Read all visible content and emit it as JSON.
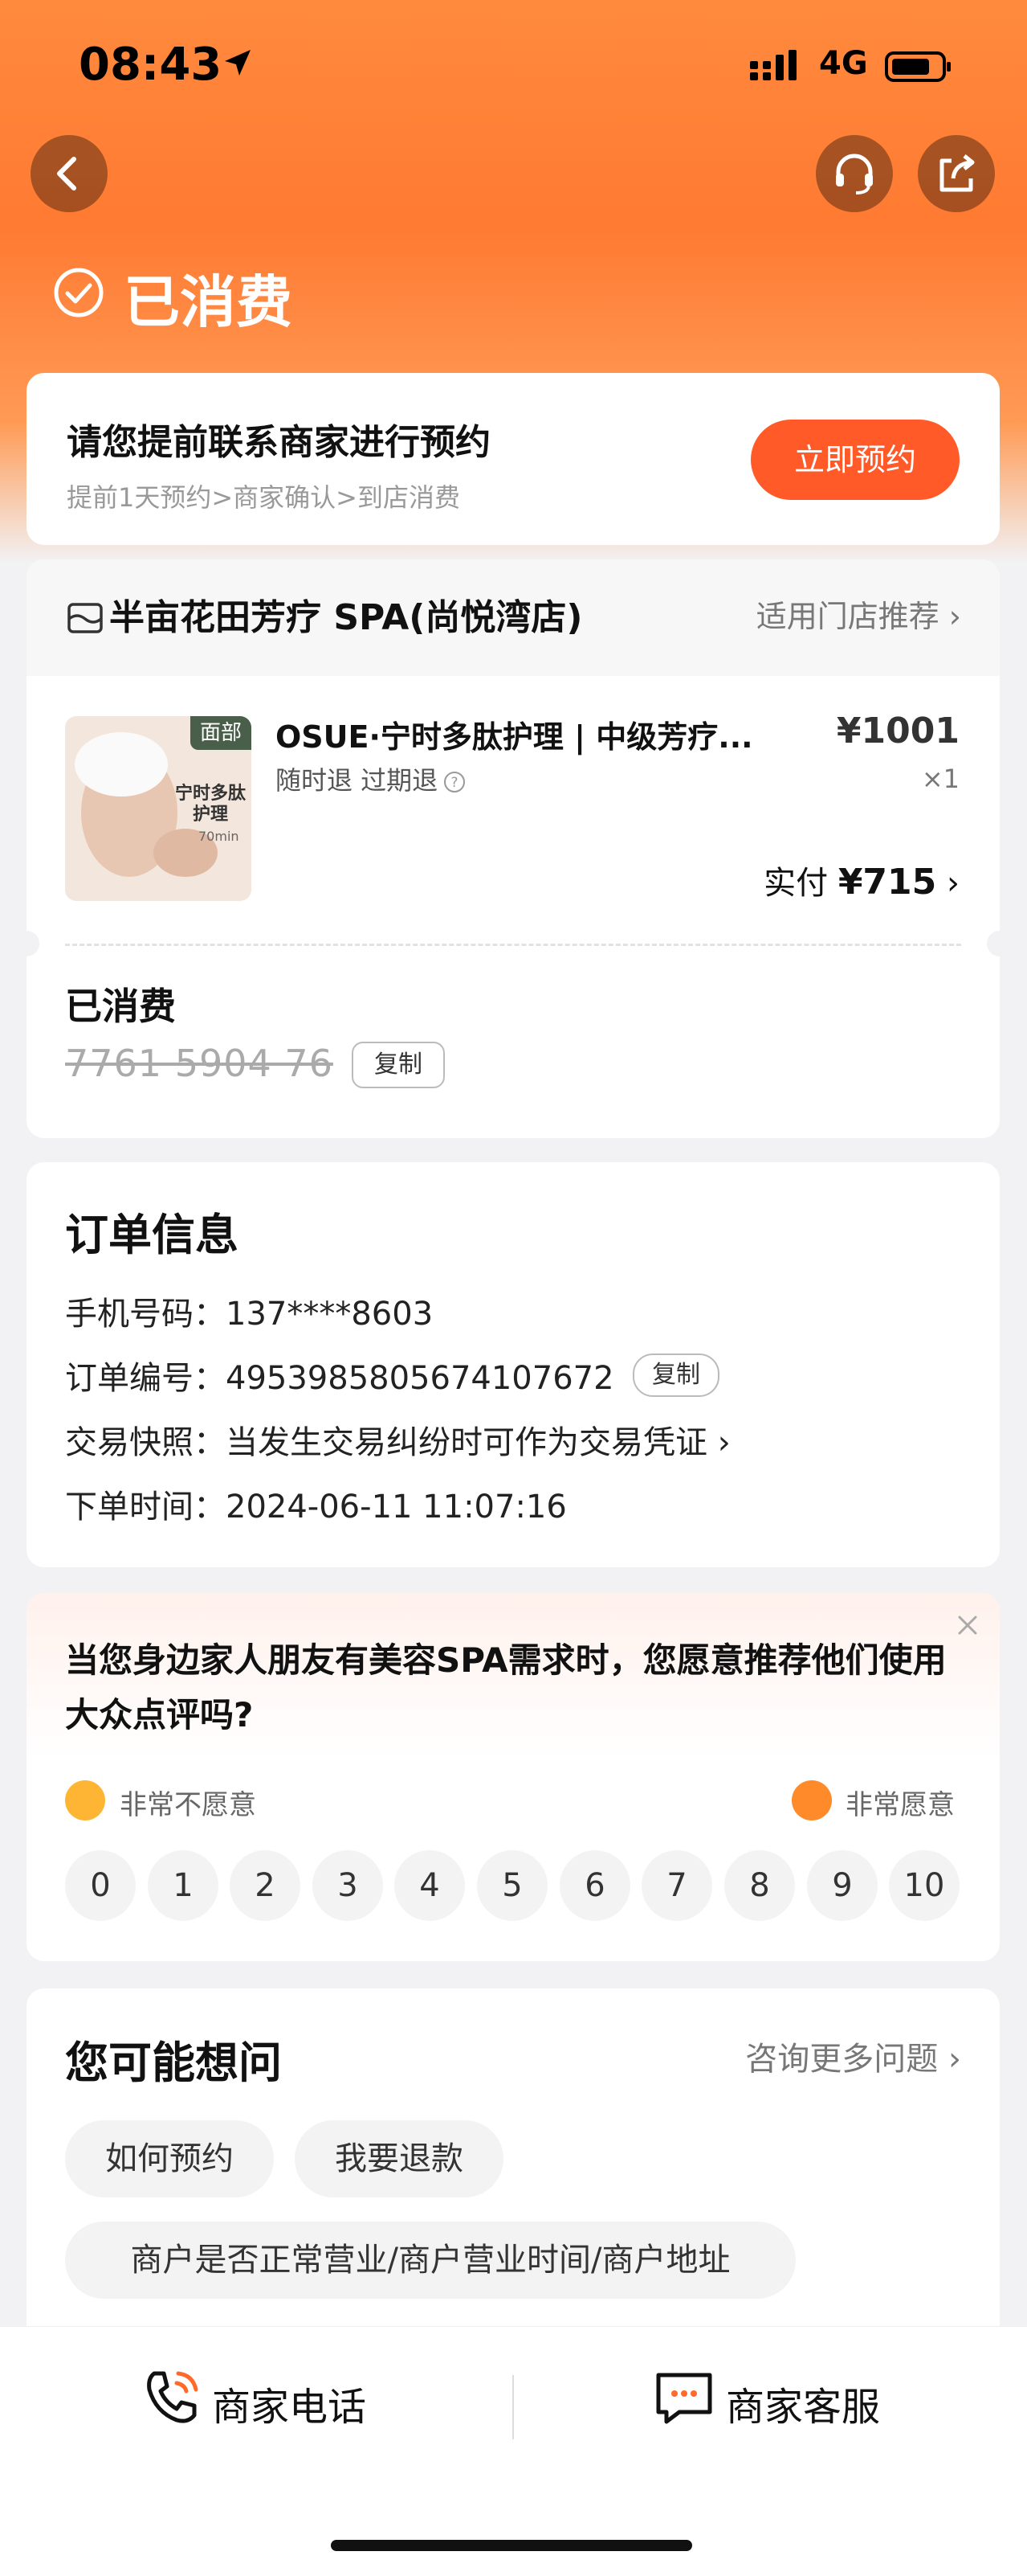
{
  "status_bar": {
    "time": "08:43",
    "network": "4G"
  },
  "header": {
    "status_title": "已消费"
  },
  "booking": {
    "main_text": "请您提前联系商家进行预约",
    "sub_text": "提前1天预约>商家确认>到店消费",
    "button": "立即预约"
  },
  "shop": {
    "name": "半亩花田芳疗 SPA(尚悦湾店)",
    "link": "适用门店推荐",
    "product": {
      "tag": "面部",
      "image_text": "宁时多肽护理",
      "image_subtext": "70min",
      "title": "OSUE·宁时多肽护理 | 中级芳疗...",
      "refund": "随时退 过期退",
      "price": "¥1001",
      "qty": "×1",
      "paid_label": "实付",
      "paid_value": "¥715"
    },
    "voucher": {
      "status": "已消费",
      "code": "7761 5904 76",
      "copy": "复制"
    }
  },
  "order": {
    "title": "订单信息",
    "phone_label": "手机号码：",
    "phone": "137****8603",
    "order_no_label": "订单编号：",
    "order_no": "4953985805674107672",
    "copy": "复制",
    "snapshot_label": "交易快照：",
    "snapshot": "当发生交易纠纷时可作为交易凭证",
    "time_label": "下单时间：",
    "time": "2024-06-11 11:07:16"
  },
  "survey": {
    "question": "当您身边家人朋友有美容SPA需求时，您愿意推荐他们使用大众点评吗?",
    "low_label": "非常不愿意",
    "high_label": "非常愿意",
    "scores": [
      "0",
      "1",
      "2",
      "3",
      "4",
      "5",
      "6",
      "7",
      "8",
      "9",
      "10"
    ]
  },
  "faq": {
    "title": "您可能想问",
    "more": "咨询更多问题",
    "items": [
      "如何预约",
      "我要退款",
      "商户是否正常营业/商户营业时间/商户地址"
    ]
  },
  "bottom": {
    "phone": "商家电话",
    "service": "商家客服"
  }
}
